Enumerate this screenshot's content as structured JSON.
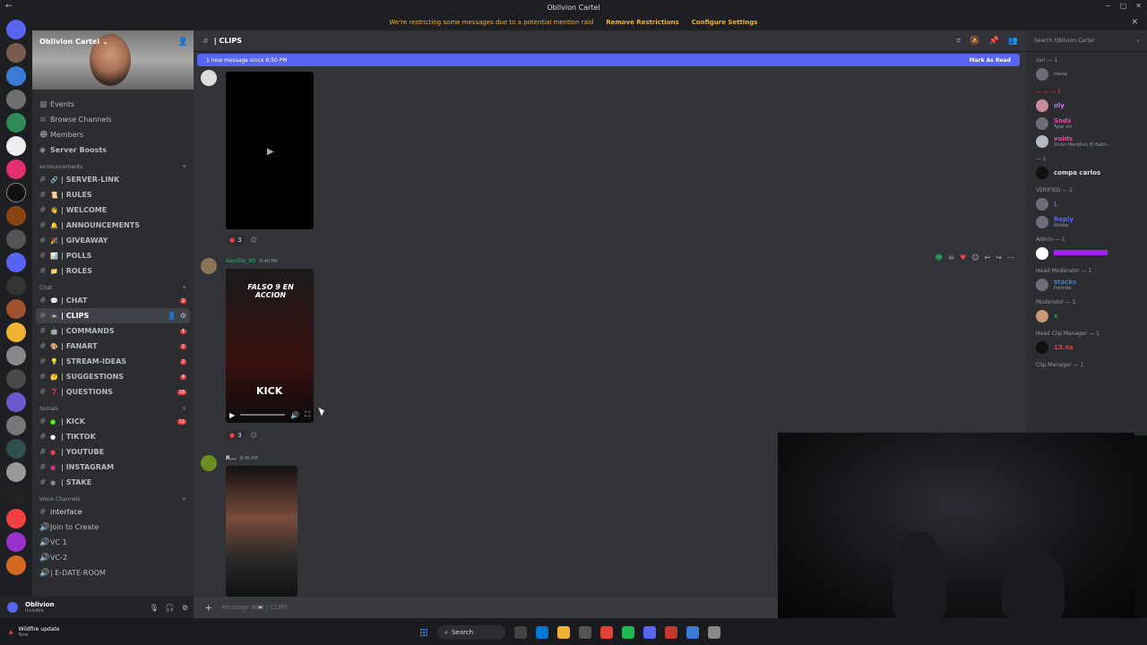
{
  "window": {
    "title": "Oblivion Cartel",
    "controls": [
      "−",
      "□",
      "✕"
    ]
  },
  "banner": {
    "text": "We're restricting some messages due to a potential mention raid",
    "link1": "Remove Restrictions",
    "link2": "Configure Settings"
  },
  "server": {
    "name": "Oblivion Cartel"
  },
  "top_items": [
    {
      "label": "Events"
    },
    {
      "label": "Browse Channels"
    },
    {
      "label": "Members"
    },
    {
      "label": "Server Boosts"
    }
  ],
  "categories": {
    "announcements": "announcements",
    "chat": "Chat",
    "socials": "Socials",
    "voice": "Voice Channels"
  },
  "channels_announce": [
    {
      "label": "| SERVER-LINK"
    },
    {
      "label": "| RULES"
    },
    {
      "label": "| WELCOME"
    },
    {
      "label": "| ANNOUNCEMENTS"
    },
    {
      "label": "| GIVEAWAY"
    },
    {
      "label": "| POLLS"
    },
    {
      "label": "| ROLES"
    }
  ],
  "channels_chat": [
    {
      "label": "| CHAT",
      "badge": "2"
    },
    {
      "label": "| CLIPS",
      "badge": ""
    },
    {
      "label": "| COMMANDS",
      "badge": "1"
    },
    {
      "label": "| FANART",
      "badge": "2"
    },
    {
      "label": "| STREAM-IDEAS",
      "badge": "2"
    },
    {
      "label": "| SUGGESTIONS",
      "badge": "4"
    },
    {
      "label": "| QUESTIONS",
      "badge": "18"
    }
  ],
  "channels_socials": [
    {
      "label": "| KICK",
      "badge": "12"
    },
    {
      "label": "| TIKTOK",
      "badge": ""
    },
    {
      "label": "| YOUTUBE",
      "badge": ""
    },
    {
      "label": "| INSTAGRAM",
      "badge": ""
    },
    {
      "label": "| STAKE",
      "badge": ""
    }
  ],
  "voice": [
    {
      "label": "interface"
    },
    {
      "label": "Join to Create"
    },
    {
      "label": "VC 1"
    },
    {
      "label": "VC-2"
    },
    {
      "label": "| E-DATE-ROOM"
    }
  ],
  "user": {
    "name": "Oblivion",
    "status": "Invisible"
  },
  "chat": {
    "channel": "| CLIPS",
    "new_message": "1 new message since 8:50 PM",
    "mark_read": "Mark As Read",
    "reaction1": "3",
    "reaction2": "3",
    "author2": "Gorilla_99",
    "time2": "8:40 PM",
    "author3": "R...",
    "time3": "8:46 PM",
    "video_text1": "FALSO 9 EN ACCION",
    "video_text2": "KICK",
    "placeholder": "Message #📼 | CLIPS"
  },
  "members": {
    "search": "Search Oblivion Cartel",
    "groups": [
      {
        "role": "zen — 1",
        "items": [
          {
            "name": "",
            "sub": "meow"
          }
        ]
      },
      {
        "role": "— — — 3",
        "items": [
          {
            "name": "oly",
            "sub": ""
          },
          {
            "name": "Sndx",
            "sub": "Type shi"
          },
          {
            "name": "voids",
            "sub": "Victor Mendivil, El Padri..."
          }
        ]
      },
      {
        "role": "— 1",
        "items": [
          {
            "name": "compa carlos",
            "sub": ""
          }
        ]
      },
      {
        "role": "VERIFIED — 2",
        "items": [
          {
            "name": "L",
            "sub": ""
          },
          {
            "name": "Reply",
            "sub": "Roblox"
          }
        ]
      },
      {
        "role": "Admin — 1",
        "items": [
          {
            "name": "",
            "sub": ""
          }
        ]
      },
      {
        "role": "Head Moderator — 1",
        "items": [
          {
            "name": "stacks",
            "sub": "Fortnite"
          }
        ]
      },
      {
        "role": "Moderator — 1",
        "items": [
          {
            "name": "x",
            "sub": ""
          }
        ]
      },
      {
        "role": "Head Clip Manager — 1",
        "items": [
          {
            "name": "13.ns",
            "sub": ""
          }
        ]
      },
      {
        "role": "Clip Manager — 1",
        "items": []
      }
    ]
  },
  "taskbar": {
    "notif_title": "Wildfire update",
    "notif_sub": "Now",
    "search": "Search"
  },
  "colors": {
    "accent": "#5865f2",
    "warning": "#f0b232",
    "badge": "#f23f43"
  }
}
